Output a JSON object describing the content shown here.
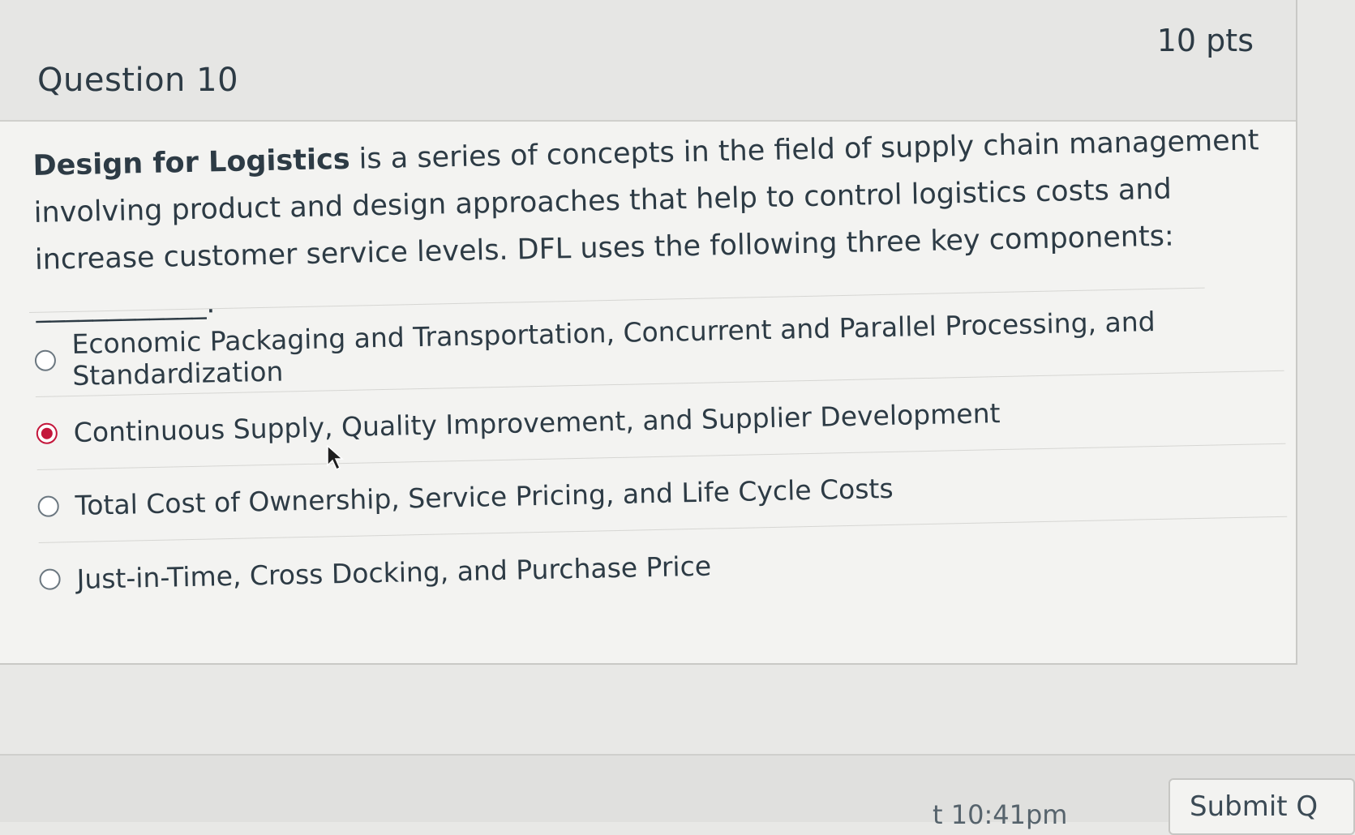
{
  "question": {
    "title": "Question 10",
    "points": "10 pts",
    "text_strong": "Design for Logistics",
    "text_rest": " is a series of concepts in the field of supply chain management involving product and design approaches that help to control logistics costs and increase customer service levels. DFL uses the following three key components: ____________."
  },
  "answers": [
    {
      "label": "Economic Packaging and Transportation, Concurrent and Parallel Processing, and Standardization",
      "selected": false
    },
    {
      "label": "Continuous Supply, Quality Improvement, and Supplier Development",
      "selected": true
    },
    {
      "label": "Total Cost of Ownership, Service Pricing, and Life Cycle Costs",
      "selected": false
    },
    {
      "label": "Just-in-Time, Cross Docking, and Purchase Price",
      "selected": false
    }
  ],
  "footer": {
    "saved_time": "t 10:41pm",
    "submit_label": "Submit Q"
  },
  "colors": {
    "selected_radio": "#c4163b",
    "text": "#2d3b45"
  },
  "icons": {
    "cursor": "mouse-pointer-icon"
  }
}
